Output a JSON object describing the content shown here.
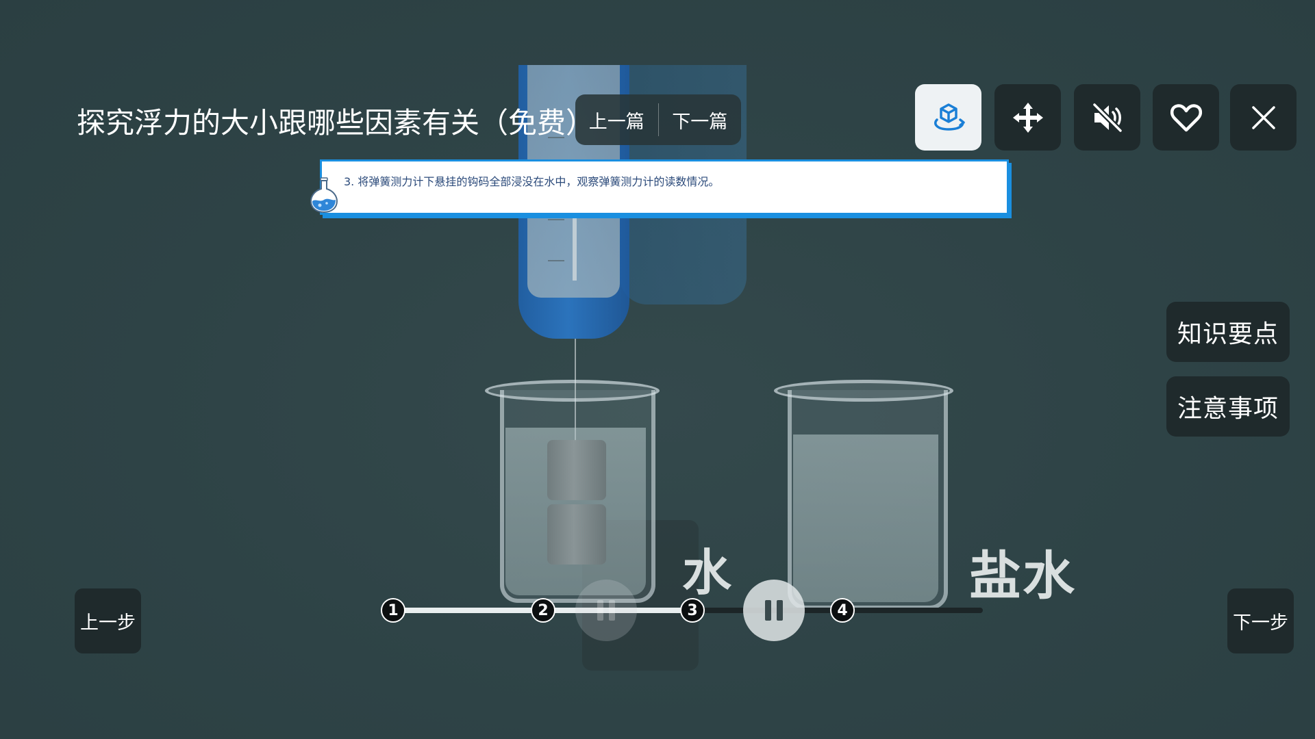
{
  "title": "探究浮力的大小跟哪些因素有关（免费）",
  "article_nav": {
    "prev_label": "上一篇",
    "next_label": "下一篇"
  },
  "toolbar": {
    "buttons": [
      {
        "name": "3d-view",
        "icon": "rotate-cube-icon",
        "active": true
      },
      {
        "name": "move",
        "icon": "move-arrows-icon",
        "active": false
      },
      {
        "name": "mute",
        "icon": "speaker-muted-icon",
        "active": false
      },
      {
        "name": "favorite",
        "icon": "heart-icon",
        "active": false
      },
      {
        "name": "close",
        "icon": "close-icon",
        "active": false
      }
    ]
  },
  "instruction": {
    "text": "3. 将弹簧测力计下悬挂的钩码全部浸没在水中，观察弹簧测力计的读数情况。",
    "icon": "flask-icon"
  },
  "side_buttons": {
    "key_points_label": "知识要点",
    "notes_label": "注意事项"
  },
  "step_nav": {
    "prev_label": "上一步",
    "next_label": "下一步"
  },
  "progress": {
    "steps": [
      "1",
      "2",
      "3",
      "4"
    ],
    "current_step": 3
  },
  "scene": {
    "labels": {
      "water": "水",
      "salt_water": "盐水"
    },
    "meter_scale": [
      "0",
      "1",
      "4",
      "5",
      "400",
      "500"
    ]
  },
  "colors": {
    "background": "#2f4447",
    "accent_blue": "#1a8fe0",
    "button_dark": "#1f2a2c",
    "active_button": "#eef2f4"
  }
}
